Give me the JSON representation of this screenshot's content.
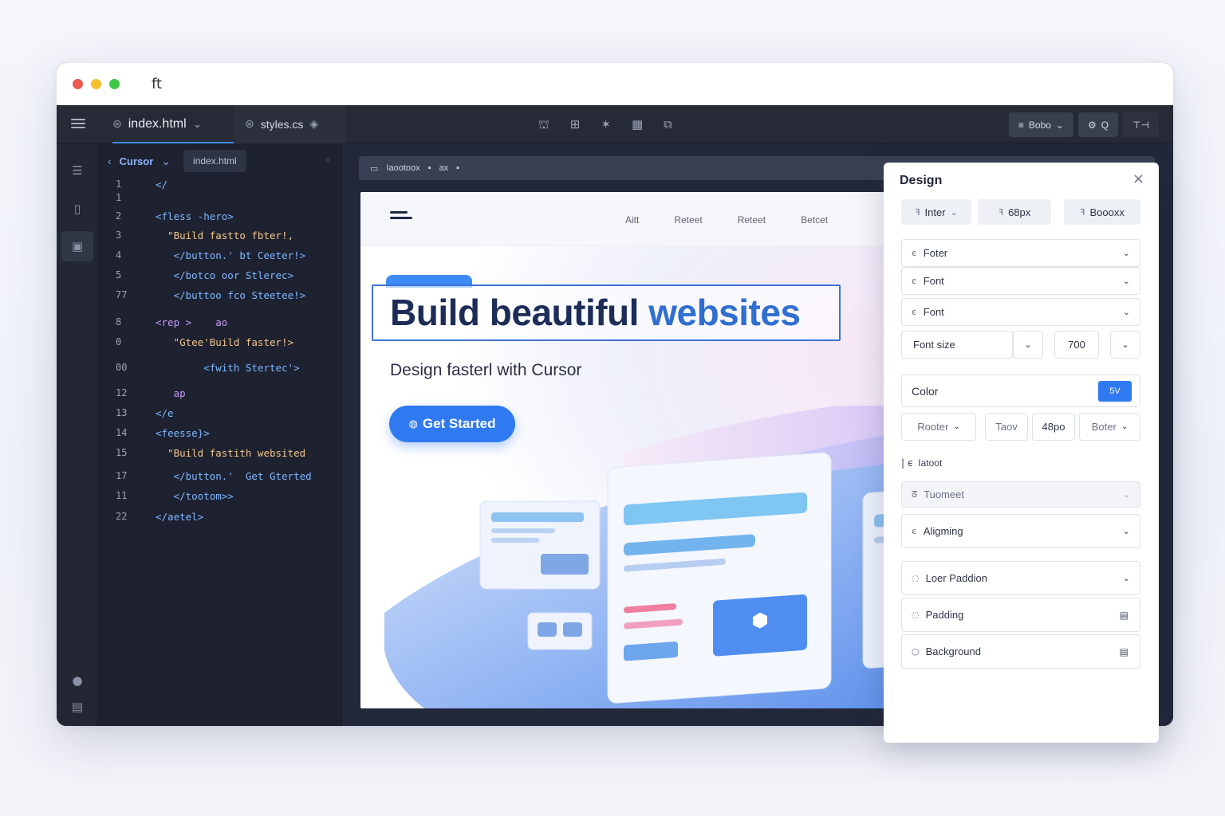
{
  "titlebar": {
    "app_glyph": "ft"
  },
  "tabs": [
    {
      "label": "index.html",
      "icon": "file-html-icon"
    },
    {
      "label": "styles.cs",
      "icon": "file-css-icon"
    }
  ],
  "topbar_right": {
    "btn1": "Bobo",
    "btn2": "Q"
  },
  "editor": {
    "breadcrumb": "Cursor",
    "file_chip": "index.html",
    "lines": [
      {
        "n": "1",
        "t": "</"
      },
      {
        "n": "1",
        "t": ""
      },
      {
        "n": "2",
        "t": "<fless -hero>"
      },
      {
        "n": "3",
        "t": "  \"Build fastto fbter!,"
      },
      {
        "n": "4",
        "t": "   </button.' bt Ceeter!>"
      },
      {
        "n": "5",
        "t": "   </botco oor Stlerec>"
      },
      {
        "n": "77",
        "t": "   </buttoo fco Steetee!>"
      },
      {
        "n": "8",
        "t": "<rep >    ao"
      },
      {
        "n": "0",
        "t": "   \"Gtee'Build faster!>"
      },
      {
        "n": "00",
        "t": "        <fwith Stertec'>"
      },
      {
        "n": "12",
        "t": "   ap"
      },
      {
        "n": "13",
        "t": "</e"
      },
      {
        "n": "14",
        "t": "<feesse}>"
      },
      {
        "n": "15",
        "t": "  \"Build fastith websited"
      },
      {
        "n": "17",
        "t": "   </button.'  Get Gterted"
      },
      {
        "n": "11",
        "t": "   </tootom>>"
      },
      {
        "n": "22",
        "t": "</aetel>"
      }
    ]
  },
  "preview_bar": {
    "label": "Iaootoox",
    "b2": "ax"
  },
  "preview": {
    "nav_links": [
      "Aitt",
      "Reteet",
      "Reteet",
      "Betcet"
    ],
    "hero_title_main": "Build beautiful",
    "hero_title_accent": "websites",
    "hero_sub": "Design fasterl with Cursor",
    "cta_label": "Get Started"
  },
  "design": {
    "title": "Design",
    "chips": {
      "font": "Inter",
      "size": "68px",
      "third": "Boooxx"
    },
    "fields": {
      "f1": "Foter",
      "f2": "Font",
      "f3": "Font"
    },
    "font_size_label": "Font size",
    "weight_value": "700",
    "color_label": "Color",
    "color_swatch_text": "5V",
    "row2": {
      "a": "Rooter",
      "b": "Taov",
      "c": "48po",
      "d": "Boter"
    },
    "section_label": "Iatoot",
    "section_field": "Tuomeet",
    "alignment": "Aligming",
    "loer_padding": "Loer Paddion",
    "padding": "Padding",
    "background": "Background"
  },
  "colors": {
    "accent": "#2f7af0",
    "title": "#1d2d58",
    "editor_bg": "#1e2230"
  }
}
